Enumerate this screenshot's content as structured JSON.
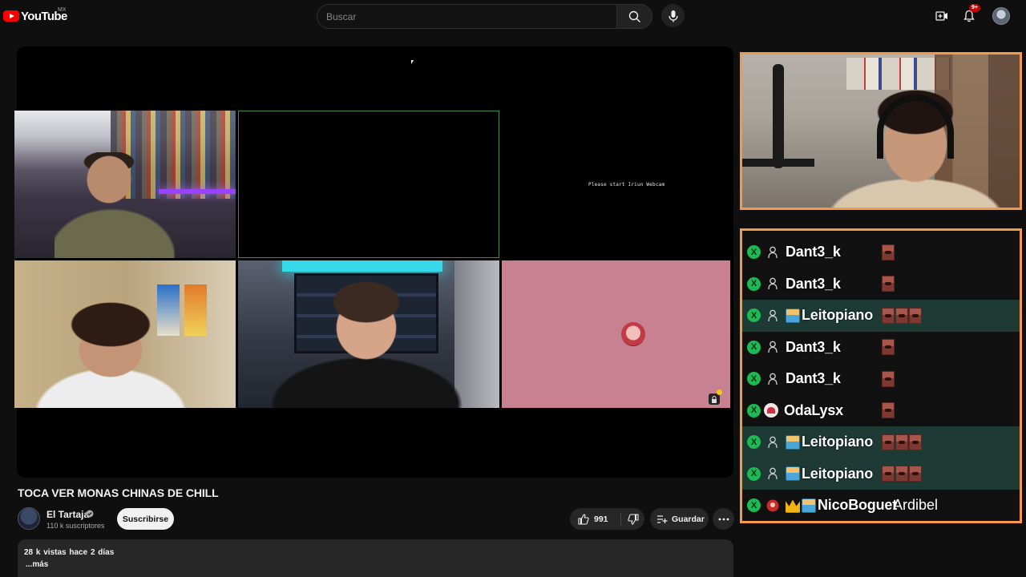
{
  "masthead": {
    "logo_text": "YouTube",
    "country_code": "MX",
    "search_placeholder": "Buscar",
    "notification_count": "9+",
    "icons": [
      "create-video-icon",
      "bell-icon",
      "search-icon",
      "microphone-icon"
    ]
  },
  "player": {
    "webcam_message": "Please start Iriun Webcam"
  },
  "chat": {
    "accent_color": "#f09a4a",
    "rows": [
      {
        "name": "Dant3_k",
        "highlight": false,
        "badges": [],
        "emotes": 1,
        "message": ""
      },
      {
        "name": "Dant3_k",
        "highlight": false,
        "badges": [],
        "emotes": 1,
        "message": ""
      },
      {
        "name": "Leitopiano",
        "highlight": true,
        "badges": [
          "avatar"
        ],
        "emotes": 3,
        "message": ""
      },
      {
        "name": "Dant3_k",
        "highlight": false,
        "badges": [],
        "emotes": 1,
        "message": ""
      },
      {
        "name": "Dant3_k",
        "highlight": false,
        "badges": [],
        "emotes": 1,
        "message": ""
      },
      {
        "name": "OdaLysx",
        "highlight": false,
        "badges": [
          "card"
        ],
        "emotes": 1,
        "message": ""
      },
      {
        "name": "Leitopiano",
        "highlight": true,
        "badges": [
          "avatar"
        ],
        "emotes": 3,
        "message": ""
      },
      {
        "name": "Leitopiano",
        "highlight": true,
        "badges": [
          "avatar"
        ],
        "emotes": 3,
        "message": ""
      },
      {
        "name": "NicoBoguet",
        "highlight": false,
        "badges": [
          "crown",
          "avatar"
        ],
        "emotes": 0,
        "message": "Ardibel"
      }
    ]
  },
  "video": {
    "title": "TOCA VER MONAS CHINAS DE CHILL",
    "channel_name": "El Tartaja",
    "subscribers": "110 k suscriptores",
    "subscribe_label": "Suscribirse",
    "likes": "991",
    "save_label": "Guardar",
    "views_date": "28 k vistas  hace 2 días",
    "more_label": "...más"
  }
}
